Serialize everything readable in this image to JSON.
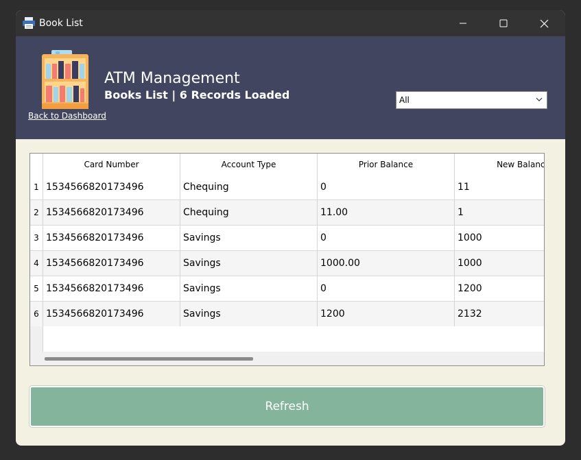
{
  "window": {
    "title": "Book List"
  },
  "header": {
    "app_title": "ATM Management",
    "subtitle": "Books List | 6 Records Loaded",
    "back_link": "Back to Dashboard",
    "filter_value": "All"
  },
  "table": {
    "columns": [
      "Card Number",
      "Account Type",
      "Prior Balance",
      "New Balance"
    ],
    "rows": [
      {
        "num": "1",
        "card": "1534566820173496",
        "type": "Chequing",
        "prior": "0",
        "new": "11"
      },
      {
        "num": "2",
        "card": "1534566820173496",
        "type": "Chequing",
        "prior": "11.00",
        "new": "1"
      },
      {
        "num": "3",
        "card": "1534566820173496",
        "type": "Savings",
        "prior": "0",
        "new": "1000"
      },
      {
        "num": "4",
        "card": "1534566820173496",
        "type": "Savings",
        "prior": "1000.00",
        "new": "1000"
      },
      {
        "num": "5",
        "card": "1534566820173496",
        "type": "Savings",
        "prior": "0",
        "new": "1200"
      },
      {
        "num": "6",
        "card": "1534566820173496",
        "type": "Savings",
        "prior": "1200",
        "new": "2132"
      }
    ]
  },
  "actions": {
    "refresh_label": "Refresh"
  },
  "colors": {
    "header_bg": "#414560",
    "body_bg": "#f3f1e2",
    "refresh_bg": "#84b59c",
    "titlebar_bg": "#333333"
  }
}
